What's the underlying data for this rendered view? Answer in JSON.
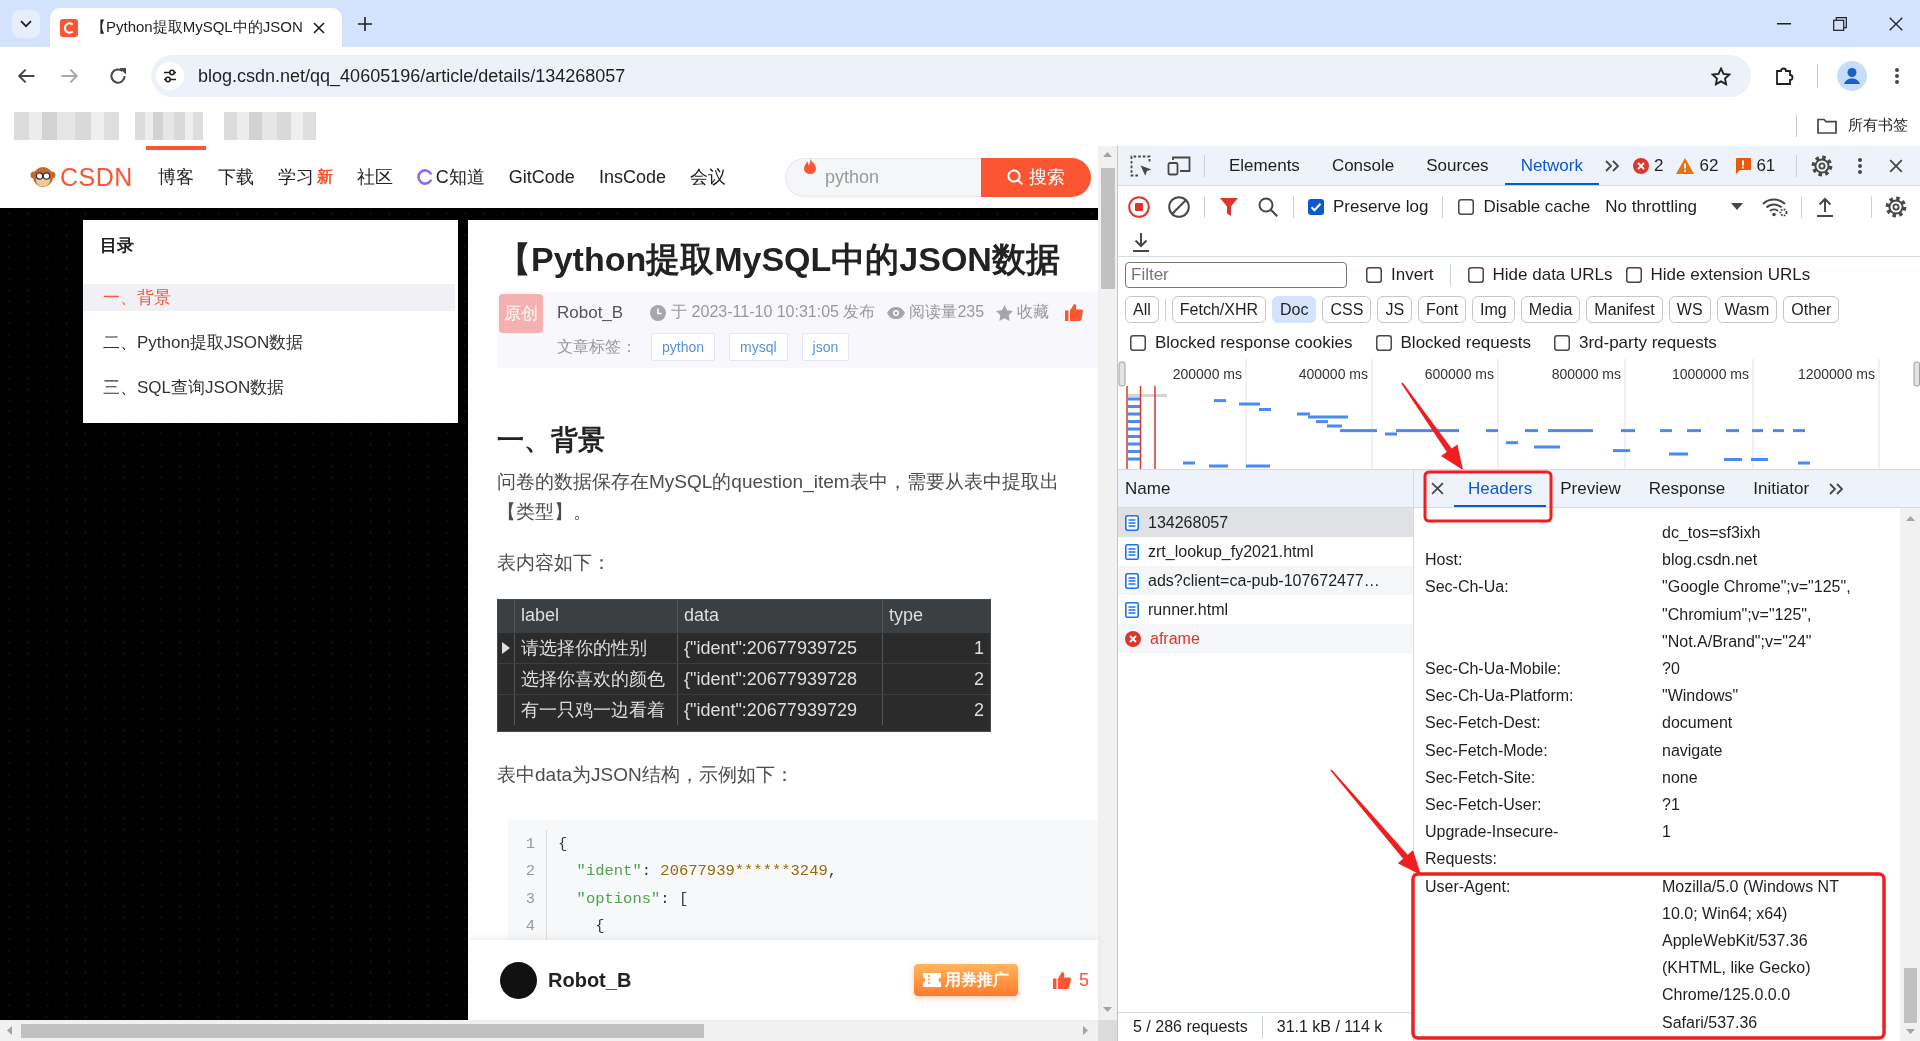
{
  "browser": {
    "tabs": [
      {
        "title": "【Python提取MySQL中的JSON",
        "selected": true
      }
    ],
    "address": "blog.csdn.net/qq_40605196/article/details/134268057",
    "bookmarks_folder": "所有书签"
  },
  "page": {
    "logo": "CSDN",
    "nav": [
      {
        "label": "博客",
        "kind": "plain",
        "selected": true
      },
      {
        "label": "下载",
        "kind": "plain",
        "selected": false
      },
      {
        "label": "学习",
        "kind": "badge",
        "badge": "新",
        "selected": false
      },
      {
        "label": "社区",
        "kind": "plain",
        "selected": false
      },
      {
        "label": "C知道",
        "kind": "icon",
        "selected": false
      },
      {
        "label": "GitCode",
        "kind": "plain",
        "selected": false
      },
      {
        "label": "InsCode",
        "kind": "plain",
        "selected": false
      },
      {
        "label": "会议",
        "kind": "plain",
        "selected": false
      }
    ],
    "search": {
      "placeholder": "python",
      "button": "搜索"
    },
    "toc": {
      "title": "目录",
      "items": [
        {
          "label": "一、背景",
          "selected": true
        },
        {
          "label": "二、Python提取JSON数据",
          "selected": false
        },
        {
          "label": "三、SQL查询JSON数据",
          "selected": false
        }
      ]
    },
    "article": {
      "title": "【Python提取MySQL中的JSON数据",
      "badge": "原创",
      "author": "Robot_B",
      "published": "于 2023-11-10 10:31:05 发布",
      "reads": "阅读量235",
      "collect": "收藏",
      "tags_label": "文章标签：",
      "tags": [
        "python",
        "mysql",
        "json"
      ],
      "blocks": [
        {
          "kind": "heading",
          "text": "一、背景"
        },
        {
          "kind": "paragraph",
          "lines": [
            "问卷的数据保存在MySQL的question_item表中，需要从表中提取出",
            "【类型】。"
          ]
        },
        {
          "kind": "paragraph",
          "lines": [
            "表内容如下："
          ]
        },
        {
          "kind": "grid",
          "columns": [
            "label",
            "data",
            "type"
          ],
          "rows": [
            {
              "current": true,
              "cells": [
                "请选择你的性别",
                "{\"ident\":20677939725",
                "1"
              ]
            },
            {
              "current": false,
              "cells": [
                "选择你喜欢的颜色",
                "{\"ident\":20677939728",
                "2"
              ]
            },
            {
              "current": false,
              "cells": [
                "有一只鸡一边看着",
                "{\"ident\":20677939729",
                "2"
              ]
            }
          ]
        },
        {
          "kind": "paragraph",
          "lines": [
            "表中data为JSON结构，示例如下："
          ]
        },
        {
          "kind": "code",
          "lines": [
            {
              "number": "1",
              "tokens": [
                {
                  "kind": "plain",
                  "text": "{"
                }
              ]
            },
            {
              "number": "2",
              "tokens": [
                {
                  "kind": "key",
                  "text": "  \"ident\""
                },
                {
                  "kind": "plain",
                  "text": ": "
                },
                {
                  "kind": "number",
                  "text": "20677939******3249"
                },
                {
                  "kind": "plain",
                  "text": ","
                }
              ]
            },
            {
              "number": "3",
              "tokens": [
                {
                  "kind": "key",
                  "text": "  \"options\""
                },
                {
                  "kind": "plain",
                  "text": ": ["
                }
              ]
            },
            {
              "number": "4",
              "tokens": [
                {
                  "kind": "plain",
                  "text": "    {"
                }
              ]
            }
          ]
        }
      ]
    },
    "footer": {
      "author": "Robot_B",
      "promote": "用券推广",
      "likes": "5"
    }
  },
  "devtools": {
    "tabs": [
      {
        "label": "Elements",
        "selected": false
      },
      {
        "label": "Console",
        "selected": false
      },
      {
        "label": "Sources",
        "selected": false
      },
      {
        "label": "Network",
        "selected": true
      }
    ],
    "counters": [
      {
        "kind": "error",
        "count": "2"
      },
      {
        "kind": "warning",
        "count": "62"
      },
      {
        "kind": "issue",
        "count": "61"
      }
    ],
    "preserve_log": {
      "label": "Preserve log",
      "checked": true
    },
    "disable_cache": {
      "label": "Disable cache",
      "checked": false
    },
    "throttling": "No throttling",
    "filter": {
      "placeholder": "Filter"
    },
    "filter_options": [
      {
        "label": "Invert",
        "checked": false
      },
      {
        "label": "Hide data URLs",
        "checked": false
      },
      {
        "label": "Hide extension URLs",
        "checked": false
      }
    ],
    "types": [
      {
        "label": "All",
        "selected": false
      },
      {
        "label": "Fetch/XHR",
        "selected": false
      },
      {
        "label": "Doc",
        "selected": true
      },
      {
        "label": "CSS",
        "selected": false
      },
      {
        "label": "JS",
        "selected": false
      },
      {
        "label": "Font",
        "selected": false
      },
      {
        "label": "Img",
        "selected": false
      },
      {
        "label": "Media",
        "selected": false
      },
      {
        "label": "Manifest",
        "selected": false
      },
      {
        "label": "WS",
        "selected": false
      },
      {
        "label": "Wasm",
        "selected": false
      },
      {
        "label": "Other",
        "selected": false
      }
    ],
    "blocked_options": [
      {
        "label": "Blocked response cookies",
        "checked": false
      },
      {
        "label": "Blocked requests",
        "checked": false
      },
      {
        "label": "3rd-party requests",
        "checked": false
      }
    ],
    "overview_ticks": [
      "200000 ms",
      "400000 ms",
      "600000 ms",
      "800000 ms",
      "1000000 ms",
      "1200000 ms"
    ],
    "requests": {
      "column": "Name",
      "rows": [
        {
          "name": "134268057",
          "selected": true,
          "failed": false
        },
        {
          "name": "zrt_lookup_fy2021.html",
          "selected": false,
          "failed": false
        },
        {
          "name": "ads?client=ca-pub-107672477…",
          "selected": false,
          "failed": false
        },
        {
          "name": "runner.html",
          "selected": false,
          "failed": false
        },
        {
          "name": "aframe",
          "selected": false,
          "failed": true
        }
      ]
    },
    "details": {
      "tabs": [
        {
          "label": "Headers",
          "selected": true
        },
        {
          "label": "Preview",
          "selected": false
        },
        {
          "label": "Response",
          "selected": false
        },
        {
          "label": "Initiator",
          "selected": false
        }
      ],
      "headers": [
        {
          "value": "dc_tos=sf3ixh"
        },
        {
          "name": "Host:",
          "value": "blog.csdn.net"
        },
        {
          "name": "Sec-Ch-Ua:",
          "value": "\"Google Chrome\";v=\"125\", \"Chromium\";v=\"125\", \"Not.A/Brand\";v=\"24\""
        },
        {
          "name": "Sec-Ch-Ua-Mobile:",
          "value": "?0"
        },
        {
          "name": "Sec-Ch-Ua-Platform:",
          "value": "\"Windows\""
        },
        {
          "name": "Sec-Fetch-Dest:",
          "value": "document"
        },
        {
          "name": "Sec-Fetch-Mode:",
          "value": "navigate"
        },
        {
          "name": "Sec-Fetch-Site:",
          "value": "none"
        },
        {
          "name": "Sec-Fetch-User:",
          "value": "?1"
        },
        {
          "name": "Upgrade-Insecure-Requests:",
          "value": "1"
        },
        {
          "name": "User-Agent:",
          "value": "Mozilla/5.0 (Windows NT 10.0; Win64; x64) AppleWebKit/537.36 (KHTML, like Gecko) Chrome/125.0.0.0 Safari/537.36"
        }
      ]
    },
    "status": [
      "5 / 286 requests",
      "31.1 kB / 114 k"
    ]
  }
}
